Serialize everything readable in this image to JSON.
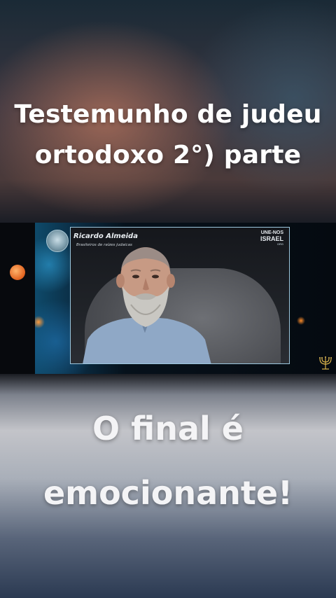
{
  "captions": {
    "top_line1": "Testemunho de judeu",
    "top_line2": "ortodoxo 2°) parte",
    "bottom_line1": "O final é",
    "bottom_line2": "emocionante!"
  },
  "video": {
    "speaker_name": "Ricardo Almeida",
    "speaker_subtitle": "Brasileiros de raízes judaicas",
    "logo_line1": "UNE-NOS",
    "logo_line2": "ISRAEL",
    "logo_line3": "ORG",
    "icons": [
      "channel-badge-icon",
      "menorah-icon"
    ],
    "accent_color": "#9cc7de"
  }
}
